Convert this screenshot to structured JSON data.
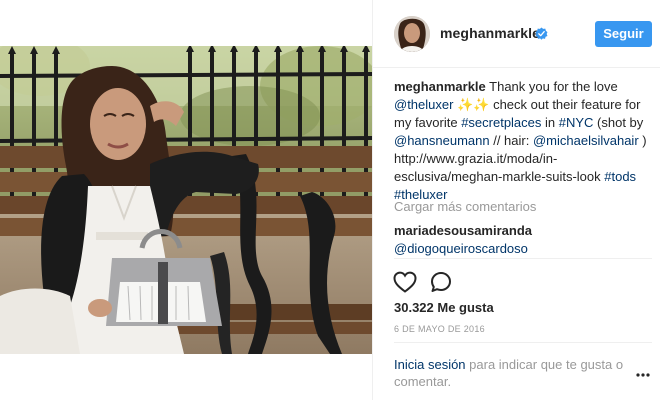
{
  "post": {
    "username": "meghanmarkle",
    "follow_label": "Seguir",
    "caption": {
      "username": "meghanmarkle",
      "segments": [
        {
          "text": " Thank you for the love ",
          "type": "text"
        },
        {
          "text": "@theluxer",
          "type": "link"
        },
        {
          "text": " ✨✨",
          "type": "text"
        },
        {
          "text": " check out their feature for my favorite ",
          "type": "text"
        },
        {
          "text": "#secretplaces",
          "type": "link"
        },
        {
          "text": " in ",
          "type": "text"
        },
        {
          "text": "#NYC",
          "type": "link"
        },
        {
          "text": " (shot by ",
          "type": "text"
        },
        {
          "text": "@hansneumann",
          "type": "link"
        },
        {
          "text": " // hair: ",
          "type": "text"
        },
        {
          "text": "@michaelsilvahair",
          "type": "link"
        },
        {
          "text": " ) http://www.grazia.it/moda/in-esclusiva/meghan-markle-suits-look ",
          "type": "text"
        },
        {
          "text": "#tods",
          "type": "link"
        },
        {
          "text": " ",
          "type": "text"
        },
        {
          "text": "#theluxer",
          "type": "link"
        }
      ]
    },
    "load_more_label": "Cargar más comentarios",
    "comment": {
      "username": "mariadesousamiranda",
      "text": "@diogoqueiroscardoso"
    },
    "likes": "30.322 Me gusta",
    "date": "6 DE MAYO DE 2016",
    "login": {
      "link_label": "Inicia sesión",
      "rest": " para indicar que te gusta o comentar."
    }
  },
  "icons": {
    "verified": "verified-badge-icon",
    "like": "heart-icon",
    "comment": "comment-bubble-icon",
    "more": "more-options-icon"
  },
  "colors": {
    "accent": "#3897f0",
    "link": "#003569",
    "muted": "#999999",
    "text": "#262626"
  }
}
